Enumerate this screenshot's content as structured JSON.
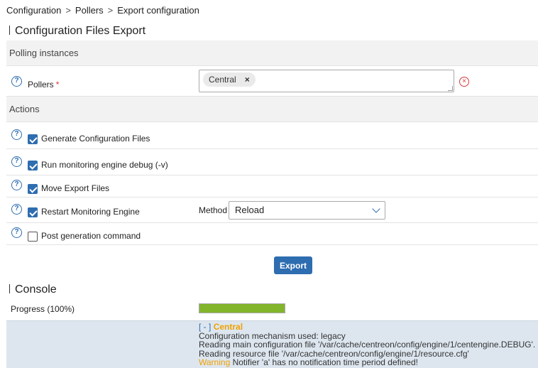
{
  "breadcrumb": [
    "Configuration",
    "Pollers",
    "Export configuration"
  ],
  "page_title": "Configuration Files Export",
  "polling_section": {
    "header": "Polling instances",
    "pollers_label": "Pollers",
    "required_mark": "*",
    "selected_chip": "Central",
    "chip_remove": "×"
  },
  "actions_section": {
    "header": "Actions",
    "options": [
      {
        "label": "Generate Configuration Files",
        "checked": true
      },
      {
        "label": "Run monitoring engine debug (-v)",
        "checked": true
      },
      {
        "label": "Move Export Files",
        "checked": true
      },
      {
        "label": "Restart Monitoring Engine",
        "checked": true
      },
      {
        "label": "Post generation command",
        "checked": false
      }
    ],
    "method_label": "Method",
    "method_value": "Reload"
  },
  "export_button": "Export",
  "console": {
    "title": "Console",
    "progress_label": "Progress (100%)",
    "progress_value": 100,
    "toggle": "[ - ]",
    "poller": "Central",
    "lines": [
      "Configuration mechanism used: legacy",
      "Reading main configuration file '/var/cache/centreon/config/engine/1/centengine.DEBUG'.",
      "Reading resource file '/var/cache/centreon/config/engine/1/resource.cfg'"
    ],
    "warning_label": "Warning",
    "warning_text": " Notifier 'a' has no notification time period defined!"
  },
  "icons": {
    "help": "help-circle-icon",
    "clear": "clear-circle-icon",
    "dropdown": "chevron-down-icon"
  },
  "colors": {
    "accent": "#2e6db0",
    "progress": "#82b52b",
    "warning": "#f0a000",
    "error": "#d9383a"
  }
}
